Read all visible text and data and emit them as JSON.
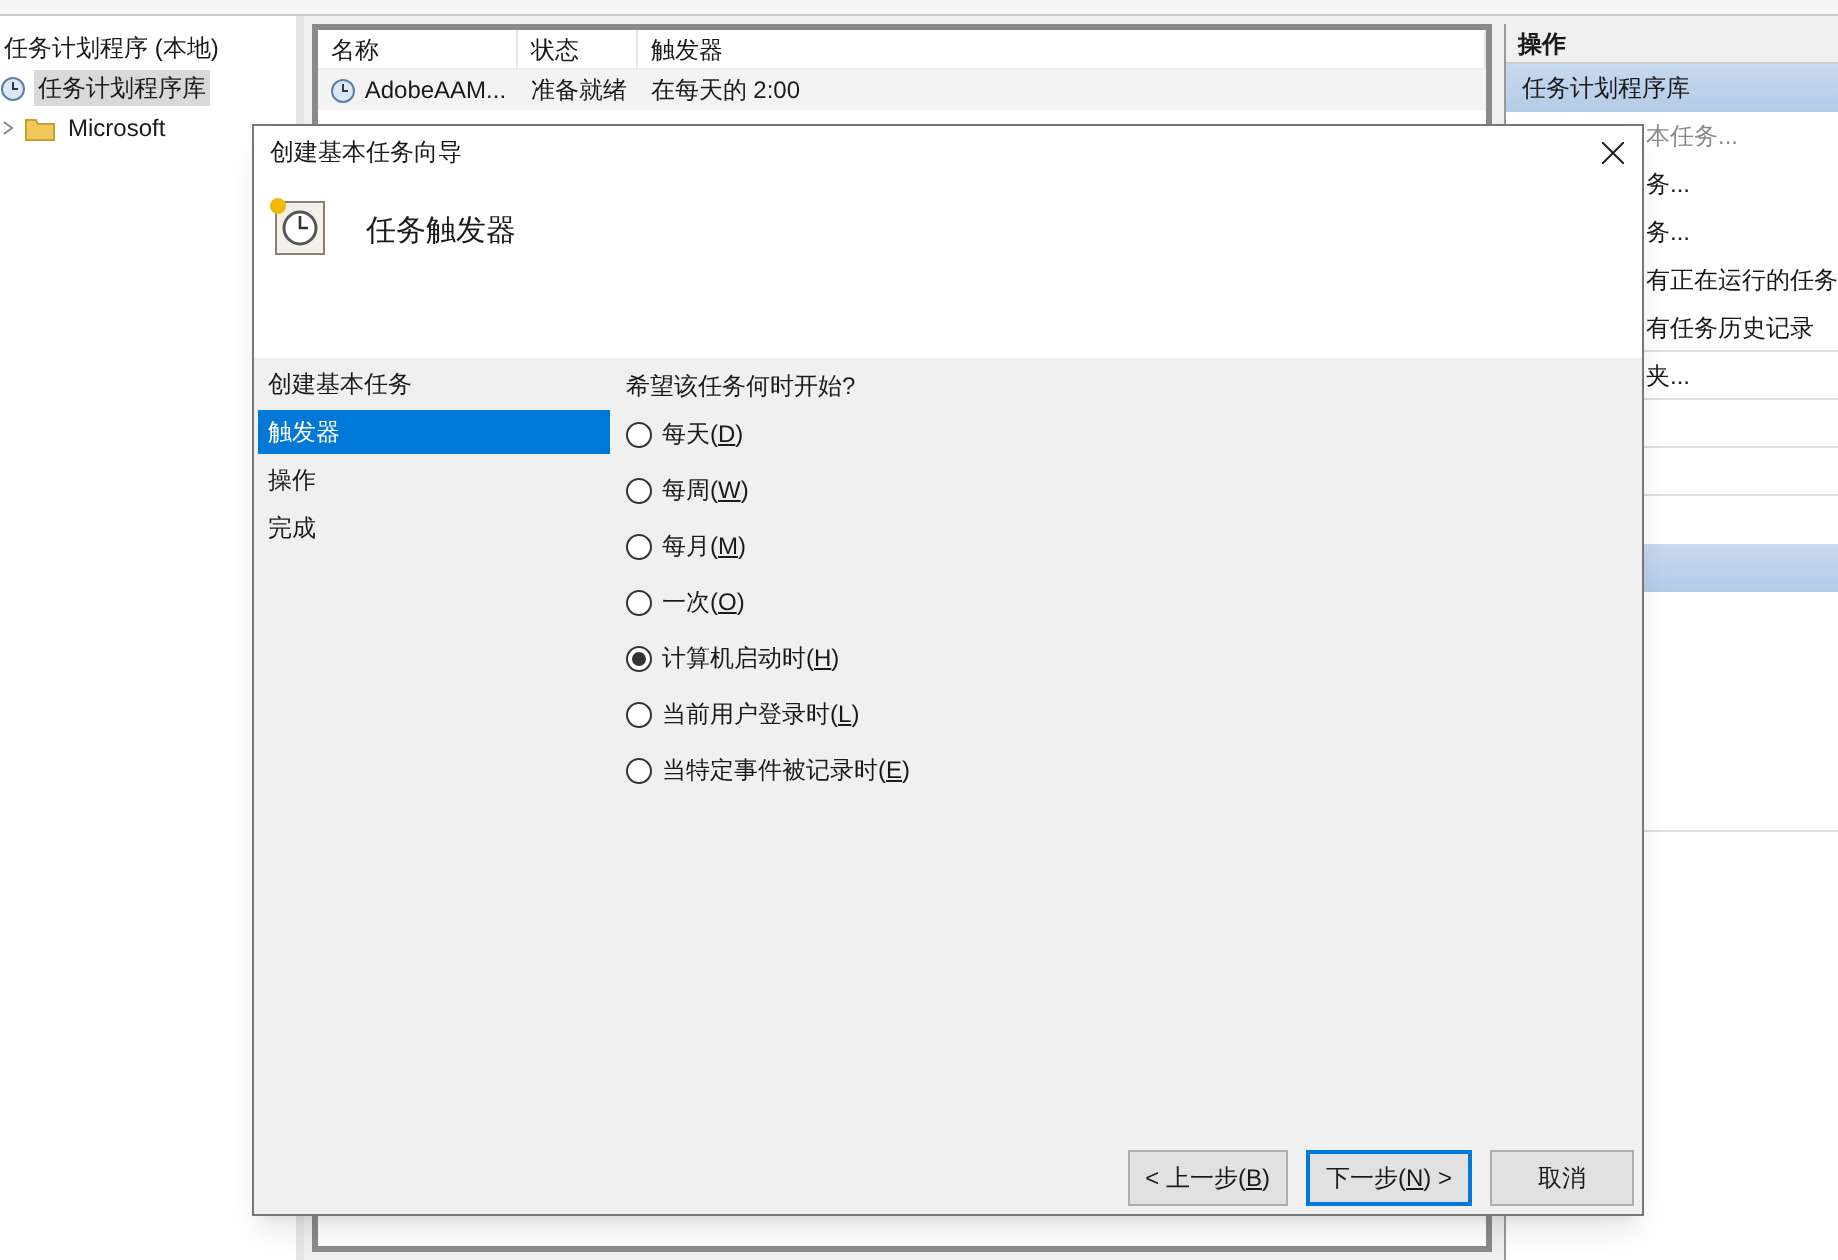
{
  "app": {
    "tree": [
      {
        "label": "任务计划程序 (本地)",
        "selected": false,
        "children": [
          {
            "label": "任务计划程序库",
            "selected": true,
            "children": [
              {
                "label": "Microsoft",
                "selected": false,
                "expanded": false
              }
            ]
          }
        ]
      }
    ],
    "table": {
      "columns": [
        "名称",
        "状态",
        "触发器"
      ],
      "rows": [
        [
          "AdobeAAM...",
          "准备就绪",
          "在每天的 2:00"
        ]
      ]
    },
    "actions": {
      "title": "操作",
      "section": "任务计划程序库",
      "items": [
        {
          "label": "本任务...",
          "disabled": true
        },
        {
          "label": "务...",
          "disabled": false
        },
        {
          "label": "务...",
          "disabled": false
        },
        {
          "label": "有正在运行的任务",
          "disabled": false
        },
        {
          "label": "有任务历史记录",
          "disabled": false
        },
        {
          "label": "夹...",
          "disabled": false
        }
      ]
    }
  },
  "dialog": {
    "title": "创建基本任务向导",
    "heading": "任务触发器",
    "steps": [
      {
        "label": "创建基本任务",
        "selected": false
      },
      {
        "label": "触发器",
        "selected": true
      },
      {
        "label": "操作",
        "selected": false
      },
      {
        "label": "完成",
        "selected": false
      }
    ],
    "question": "希望该任务何时开始?",
    "options": [
      {
        "label": "每天(D)",
        "selected": false
      },
      {
        "label": "每周(W)",
        "selected": false
      },
      {
        "label": "每月(M)",
        "selected": false
      },
      {
        "label": "一次(O)",
        "selected": false
      },
      {
        "label": "计算机启动时(H)",
        "selected": true
      },
      {
        "label": "当前用户登录时(L)",
        "selected": false
      },
      {
        "label": "当特定事件被记录时(E)",
        "selected": false
      }
    ],
    "buttons": [
      {
        "label": "< 上一步(B)",
        "focused": false
      },
      {
        "label": "下一步(N) >",
        "focused": true
      },
      {
        "label": "取消",
        "focused": false
      }
    ]
  }
}
